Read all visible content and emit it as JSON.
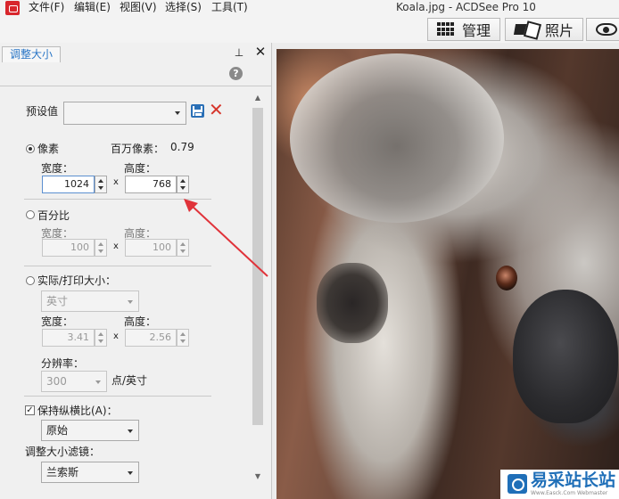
{
  "window": {
    "title": "Koala.jpg - ACDSee Pro 10",
    "menu": [
      "文件(F)",
      "编辑(E)",
      "视图(V)",
      "选择(S)",
      "工具(T)"
    ]
  },
  "modes": {
    "manage": "管理",
    "photo": "照片"
  },
  "panel": {
    "tab": "调整大小",
    "preset_label": "预设值",
    "preset_value": "",
    "pixel": {
      "label": "像素",
      "megapixel_label": "百万像素：",
      "megapixel_value": "0.79",
      "width_label": "宽度：",
      "height_label": "高度：",
      "width_value": "1024",
      "height_value": "768",
      "times": "x"
    },
    "percent": {
      "label": "百分比",
      "width_label": "宽度：",
      "height_label": "高度：",
      "width_value": "100",
      "height_value": "100",
      "times": "x"
    },
    "actual": {
      "label": "实际/打印大小：",
      "unit_value": "英寸",
      "width_label": "宽度：",
      "height_label": "高度：",
      "width_value": "3.41",
      "height_value": "2.56",
      "times": "x",
      "resolution_label": "分辨率：",
      "resolution_value": "300",
      "resolution_unit": "点/英寸"
    },
    "keep_aspect": {
      "label": "保持纵横比(A)：",
      "value": "原始",
      "checked": true
    },
    "filter": {
      "label": "调整大小滤镜：",
      "value": "兰索斯"
    }
  },
  "icons": {
    "help": "?",
    "close": "✕",
    "pin": "📌",
    "delete": "✕",
    "check": "✓"
  },
  "watermark": {
    "title": "易采站长站",
    "subtitle": "Www.Easck.Com Webmaster"
  },
  "colors": {
    "accent": "#2a76c6",
    "arrow": "#e0333a",
    "delete": "#d6352b"
  }
}
